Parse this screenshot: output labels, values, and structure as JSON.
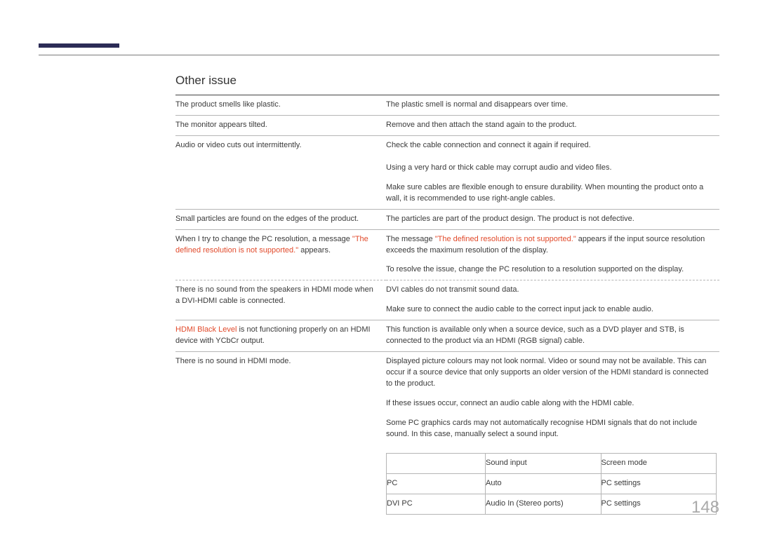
{
  "heading": "Other issue",
  "page_number": "148",
  "rows": {
    "r1_l": "The product smells like plastic.",
    "r1_r": "The plastic smell is normal and disappears over time.",
    "r2_l": "The monitor appears tilted.",
    "r2_r": "Remove and then attach the stand again to the product.",
    "r3_l": "Audio or video cuts out intermittently.",
    "r3_r1": "Check the cable connection and connect it again if required.",
    "r3_r2": "Using a very hard or thick cable may corrupt audio and video files.",
    "r3_r3": "Make sure cables are flexible enough to ensure durability. When mounting the product onto a wall, it is recommended to use right-angle cables.",
    "r4_l": "Small particles are found on the edges of the product.",
    "r4_r": "The particles are part of the product design. The product is not defective.",
    "r5_l_a": "When I try to change the PC resolution, a message ",
    "r5_l_b": "\"The defined resolution is not supported.\"",
    "r5_l_c": " appears.",
    "r5_r1_a": "The message ",
    "r5_r1_b": "\"The defined resolution is not supported.\"",
    "r5_r1_c": " appears if the input source resolution exceeds the maximum resolution of the display.",
    "r5_r2": "To resolve the issue, change the PC resolution to a resolution supported on the display.",
    "r6_l": "There is no sound from the speakers in HDMI mode when a DVI-HDMI cable is connected.",
    "r6_r1": "DVI cables do not transmit sound data.",
    "r6_r2": "Make sure to connect the audio cable to the correct input jack to enable audio.",
    "r7_l_a": "HDMI Black Level",
    "r7_l_b": " is not functioning properly on an HDMI device with YCbCr output.",
    "r7_r": "This function is available only when a source device, such as a DVD player and STB, is connected to the product via an HDMI (RGB signal) cable.",
    "r8_l": "There is no sound in HDMI mode.",
    "r8_r1": "Displayed picture colours may not look normal. Video or sound may not be available. This can occur if a source device that only supports an older version of the HDMI standard is connected to the product.",
    "r8_r2": "If these issues occur, connect an audio cable along with the HDMI cable.",
    "r8_r3": "Some PC graphics cards may not automatically recognise HDMI signals that do not include sound. In this case, manually select a sound input."
  },
  "inner": {
    "h1": "",
    "h2": "Sound input",
    "h3": "Screen mode",
    "a1": "PC",
    "a2": "Auto",
    "a3": "PC settings",
    "b1": "DVI PC",
    "b2": "Audio In (Stereo ports)",
    "b3": "PC settings"
  }
}
